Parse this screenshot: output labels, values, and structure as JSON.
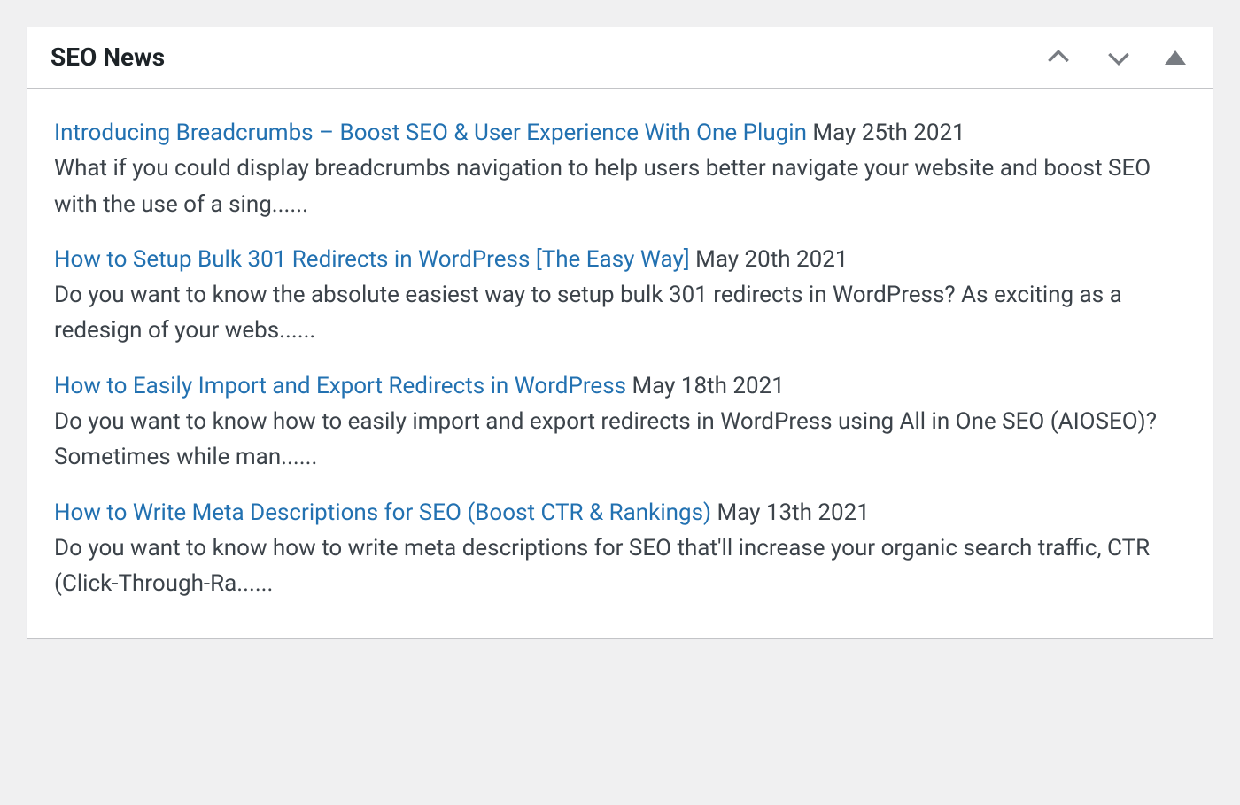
{
  "panel": {
    "title": "SEO News"
  },
  "items": [
    {
      "title": "Introducing Breadcrumbs – Boost SEO & User Experience With One Plugin",
      "date": "May 25th 2021",
      "summary": "What if you could display breadcrumbs navigation to help users better navigate your website and boost SEO with the use of a sing......"
    },
    {
      "title": "How to Setup Bulk 301 Redirects in WordPress [The Easy Way]",
      "date": "May 20th 2021",
      "summary": "Do you want to know the absolute easiest way to setup bulk 301 redirects in WordPress? As exciting as a redesign of your webs......"
    },
    {
      "title": "How to Easily Import and Export Redirects in WordPress",
      "date": "May 18th 2021",
      "summary": "Do you want to know how to easily import and export redirects in WordPress using All in One SEO (AIOSEO)? Sometimes while man......"
    },
    {
      "title": "How to Write Meta Descriptions for SEO (Boost CTR & Rankings)",
      "date": "May 13th 2021",
      "summary": "Do you want to know how to write meta descriptions for SEO that'll increase your organic search traffic, CTR (Click-Through-Ra......"
    }
  ]
}
